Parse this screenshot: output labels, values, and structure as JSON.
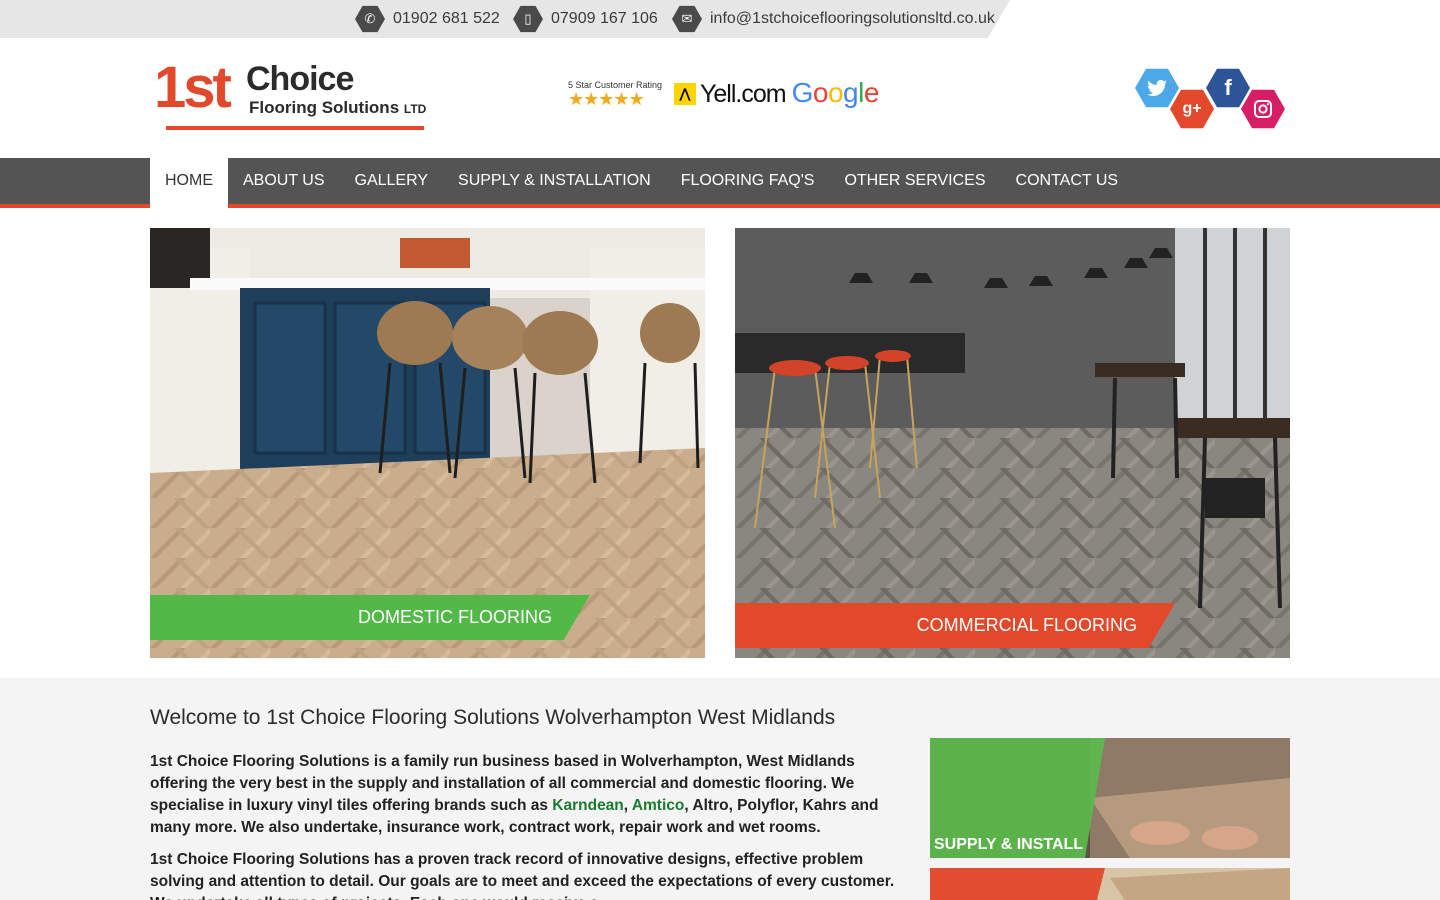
{
  "topbar": {
    "phone1": "01902 681 522",
    "phone2": "07909 167 106",
    "email": "info@1stchoiceflooringsolutionsltd.co.uk"
  },
  "logo": {
    "big": "1st",
    "name": "Choice",
    "sub": "Flooring Solutions",
    "ltd": "LTD"
  },
  "ratings": {
    "caption": "5 Star Customer Rating",
    "stars": "★★★★★",
    "yell": "Yell.com",
    "google": "Google"
  },
  "social": [
    "twitter",
    "google-plus",
    "facebook",
    "instagram"
  ],
  "nav": {
    "items": [
      "HOME",
      "ABOUT US",
      "GALLERY",
      "SUPPLY & INSTALLATION",
      "FLOORING FAQ'S",
      "OTHER SERVICES",
      "CONTACT US"
    ]
  },
  "hero": {
    "domestic": "DOMESTIC FLOORING",
    "commercial": "COMMERCIAL FLOORING"
  },
  "main": {
    "title": "Welcome to 1st Choice Flooring Solutions Wolverhampton West Midlands",
    "p1_a": "1st Choice Flooring Solutions is a family run business based in Wolverhampton, West Midlands offering the very best in the supply and installation of all commercial and domestic flooring.  We specialise in luxury vinyl tiles offering brands such as ",
    "p1_link1": "Karndean",
    "p1_sep": ", ",
    "p1_link2": "Amtico",
    "p1_b": ", Altro, Polyflor, Kahrs and many more. We also undertake, insurance work, contract work, repair work and wet rooms.",
    "p2": "1st Choice Flooring Solutions has a proven track record of innovative designs, effective problem solving and attention to detail. Our goals are to meet and exceed the expectations of every customer. We undertake all types of projects. Each one would receive a"
  },
  "sidebar": {
    "supply": "SUPPLY & INSTALL"
  },
  "colors": {
    "accent": "#e2482a",
    "green": "#52b848",
    "nav": "#545454"
  }
}
